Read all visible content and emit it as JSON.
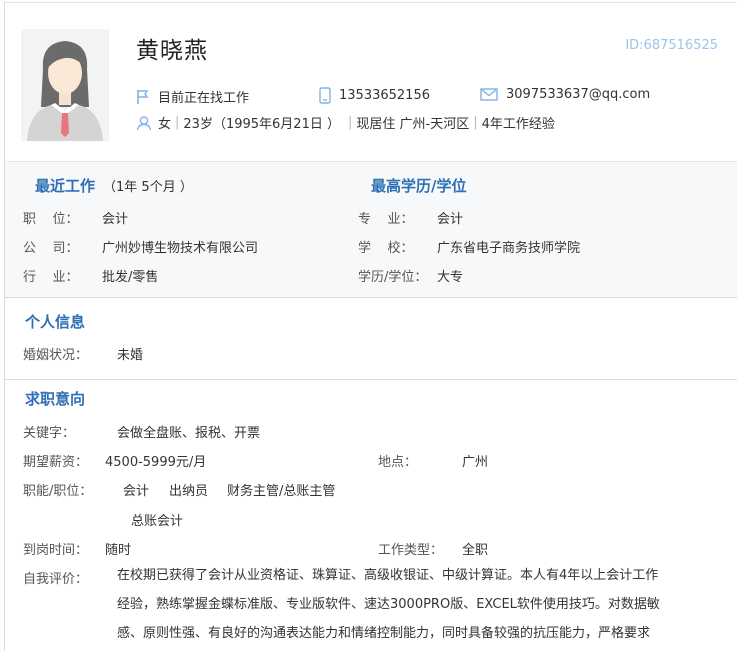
{
  "profile": {
    "name": "黄晓燕",
    "id": "ID:687516525",
    "status": "目前正在找工作",
    "phone": "13533652156",
    "email": "3097533637@qq.com",
    "gender": "女",
    "age": "23岁（1995年6月21日 ）",
    "residence": "现居住 广州-天河区",
    "experience": "4年工作经验"
  },
  "recent_work": {
    "title": "最近工作",
    "duration": "（1年 5个月 ）",
    "position_label": "职    位：",
    "position": "会计",
    "company_label": "公    司：",
    "company": "广州妙博生物技术有限公司",
    "industry_label": "行    业：",
    "industry": "批发/零售"
  },
  "education": {
    "title": "最高学历/学位",
    "major_label": "专    业：",
    "major": "会计",
    "school_label": "学    校：",
    "school": "广东省电子商务技师学院",
    "degree_label": "学历/学位：",
    "degree": "大专"
  },
  "personal": {
    "title": "个人信息",
    "marital_label": "婚姻状况：",
    "marital": "未婚"
  },
  "intent": {
    "title": "求职意向",
    "keywords_label": "关键字：",
    "keywords": "会做全盘账、报税、开票",
    "salary_label": "期望薪资：",
    "salary": "4500-5999元/月",
    "location_label": "地点：",
    "location": "广州",
    "function_label": "职能/职位：",
    "functions": [
      "会计",
      "出纳员",
      "财务主管/总账主管",
      "总账会计"
    ],
    "arrival_label": "到岗时间：",
    "arrival": "随时",
    "jobtype_label": "工作类型：",
    "jobtype": "全职",
    "self_eval_label": "自我评价：",
    "self_eval_lines": [
      "在校期已获得了会计从业资格证、珠算证、高级收银证、中级计算证。本人有4年以上会计工作",
      "经验，熟练掌握金蝶标准版、专业版软件、速达3000PRO版、EXCEL软件使用技巧。对数据敏",
      "感、原则性强、有良好的沟通表达能力和情绪控制能力，同时具备较强的抗压能力，严格要求"
    ]
  }
}
